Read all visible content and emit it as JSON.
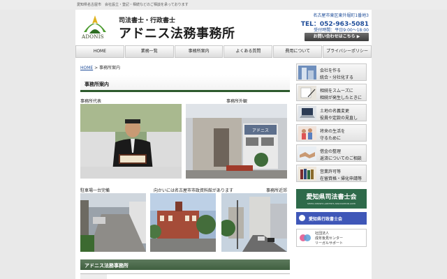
{
  "top_bar": {
    "text": "愛知県名古屋市　会社設立・登記・相続などのご相談を承っております"
  },
  "header": {
    "logo_text": "ADONIS",
    "tagline": "司法書士・行政書士",
    "firm_name": "アドニス法務事務所",
    "address": "名古屋市東区東外堀町1番地3",
    "tel": "TEL：052-963-5081",
    "hours": "受付時間：平日9:00〜18:00",
    "contact_button": "お問い合わせはこちら ▶"
  },
  "nav": [
    {
      "label": "HOME"
    },
    {
      "label": "業務一覧"
    },
    {
      "label": "事務所案内"
    },
    {
      "label": "よくある質問"
    },
    {
      "label": "費用について"
    },
    {
      "label": "プライバシーポリシー"
    }
  ],
  "breadcrumb": {
    "home": "HOME",
    "sep": " > ",
    "current": "事務所案内"
  },
  "section": {
    "title": "事務所案内",
    "photo_captions": {
      "representative": "事務所代表",
      "exterior": "事務所外観",
      "parking": "駐車場一台完備",
      "opposite": "向かいには名古屋市市政資料館があります",
      "nearby": "事務所近郊"
    },
    "office_sign": "アドニス"
  },
  "section2": {
    "title": "アドニス法務事務所"
  },
  "sidebar": [
    {
      "line1": "会社を作る",
      "line2": "統合・分社化する",
      "icon": "building-icon"
    },
    {
      "line1": "相続をスムーズに",
      "line2": "相続が発生したときに",
      "icon": "document-icon"
    },
    {
      "line1": "土地の名義変更",
      "line2": "役員や定款の見直し",
      "icon": "laptop-icon"
    },
    {
      "line1": "将来の生活を",
      "line2": "守るために",
      "icon": "family-icon"
    },
    {
      "line1": "借金の整理",
      "line2": "返済についてのご相談",
      "icon": "handshake-icon"
    },
    {
      "line1": "営業許可等",
      "line2": "在留資格・帰化申請等",
      "icon": "books-icon"
    }
  ],
  "banners": {
    "aichi_shiho": {
      "title": "愛知県司法書士会",
      "sub": "SHIHO-SHOSHI LAWYER'S ASSOCIATION AICHI"
    },
    "aichi_gyosei": {
      "title": "愛知県行政書士会"
    },
    "legal_support": {
      "line1": "社団法人",
      "line2": "成年後見センター",
      "line3": "リーガルサポート"
    }
  },
  "colors": {
    "accent_green": "#2d5a2d",
    "link_blue": "#1f4d99"
  }
}
